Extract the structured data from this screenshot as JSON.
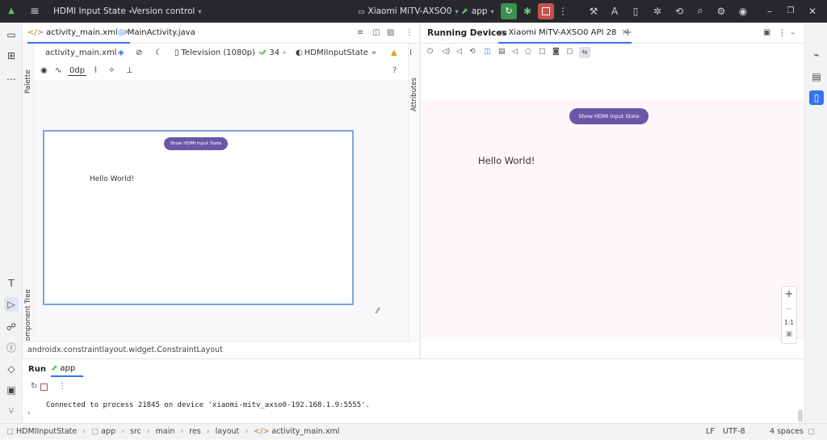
{
  "titlebar": {
    "project": "HDMI Input State",
    "vcs": "Version control",
    "device": "Xiaomi MiTV-AXSO0",
    "run_config": "app"
  },
  "editor": {
    "tabs": [
      {
        "label": "activity_main.xml"
      },
      {
        "label": "MainActivity.java"
      }
    ],
    "toolbar": {
      "file": "activity_main.xml",
      "device": "Television (1080p)",
      "api": "34",
      "theme": "HDMIInputState",
      "margin": "0dp"
    },
    "palette_label": "Palette",
    "component_tree_label": "Component Tree",
    "attributes_label": "Attributes",
    "design": {
      "button_label": "Show HDMI Input State",
      "text": "Hello World!"
    },
    "breadcrumb": "androidx.constraintlayout.widget.ConstraintLayout"
  },
  "devices": {
    "title": "Running Devices",
    "tab": "Xiaomi MiTV-AXSO0 API 28",
    "screen": {
      "button_label": "Show HDMI Input State",
      "text": "Hello World!"
    },
    "zoom_ratio": "1:1"
  },
  "run": {
    "title": "Run",
    "tab": "app",
    "console": "Connected to process 21845 on device 'xiaomi-mitv_axso0-192.168.1.9:5555'."
  },
  "statusbar": {
    "path": [
      "HDMIInputState",
      "app",
      "src",
      "main",
      "res",
      "layout",
      "activity_main.xml"
    ],
    "line_sep": "LF",
    "encoding": "UTF-8",
    "indent": "4 spaces"
  }
}
